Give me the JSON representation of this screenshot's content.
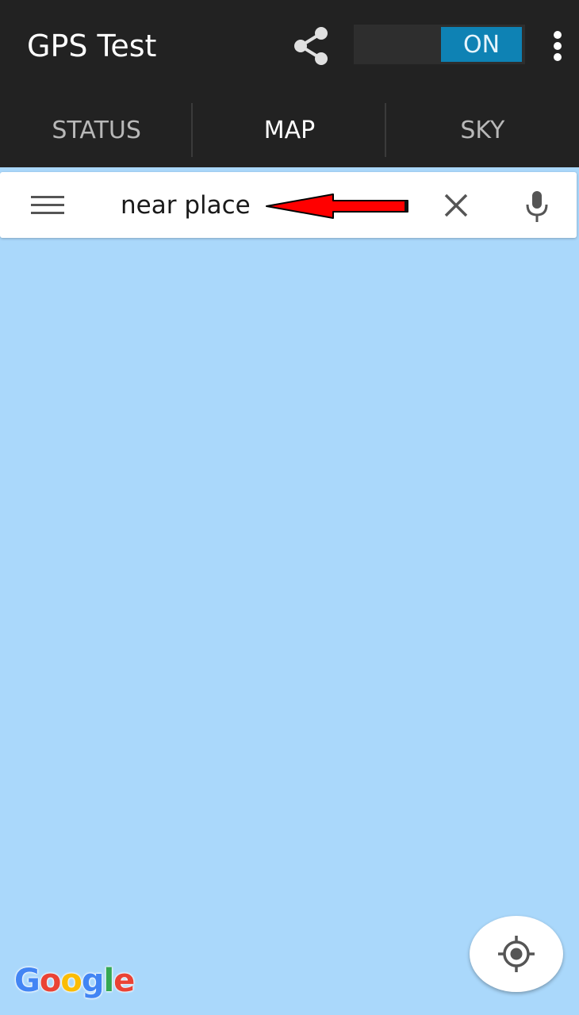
{
  "app": {
    "title": "GPS Test",
    "toggle_label": "ON",
    "icons": {
      "share": "share-icon",
      "overflow": "more-vert-icon"
    }
  },
  "tabs": [
    {
      "label": "STATUS",
      "active": false
    },
    {
      "label": "MAP",
      "active": true
    },
    {
      "label": "SKY",
      "active": false
    }
  ],
  "search": {
    "value": "near place",
    "icons": {
      "menu": "hamburger-icon",
      "clear": "close-icon",
      "mic": "microphone-icon"
    }
  },
  "map": {
    "attribution_letters": [
      {
        "ch": "G",
        "color": "#4285F4"
      },
      {
        "ch": "o",
        "color": "#EA4335"
      },
      {
        "ch": "o",
        "color": "#FBBC05"
      },
      {
        "ch": "g",
        "color": "#4285F4"
      },
      {
        "ch": "l",
        "color": "#34A853"
      },
      {
        "ch": "e",
        "color": "#EA4335"
      }
    ],
    "background_color": "#aad8fb",
    "my_location_icon": "my-location-icon"
  },
  "colors": {
    "appbar": "#222222",
    "toggle_on": "#0e82b4",
    "annotation_arrow": "#ff0000"
  }
}
